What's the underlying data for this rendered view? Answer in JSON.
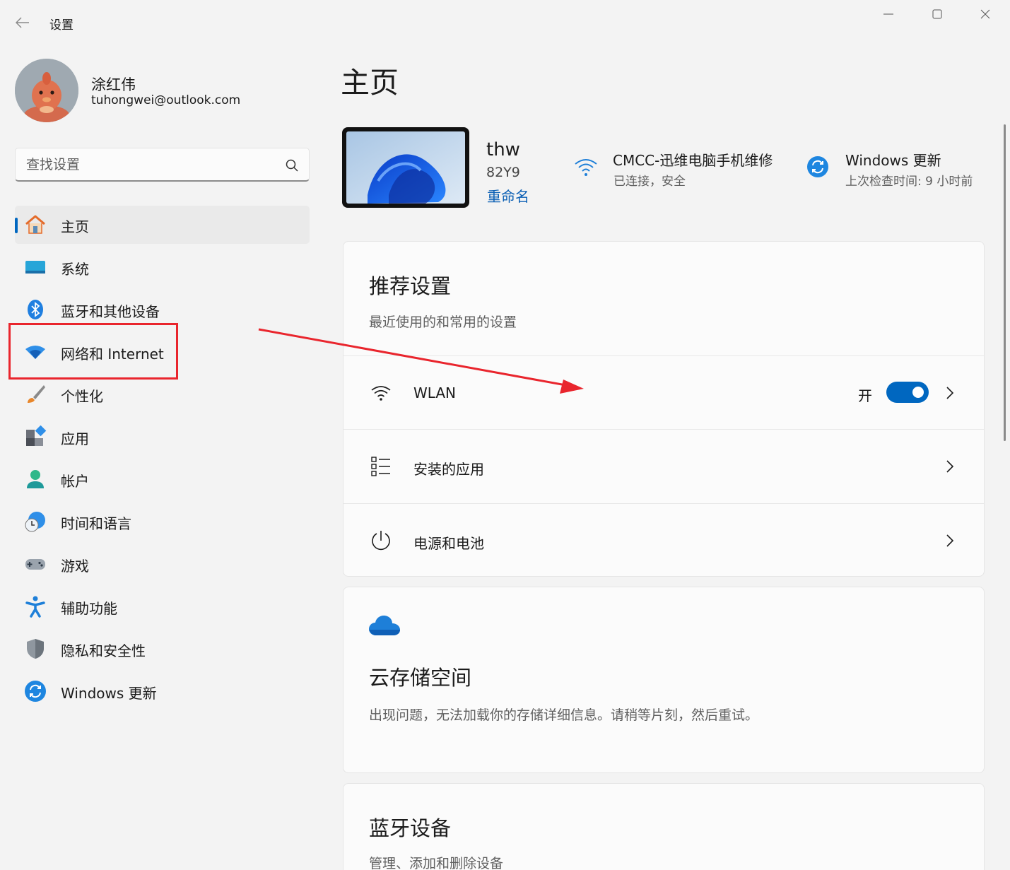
{
  "window": {
    "title": "设置"
  },
  "profile": {
    "name": "涂红伟",
    "email": "tuhongwei@outlook.com"
  },
  "search": {
    "placeholder": "查找设置"
  },
  "nav": {
    "items": [
      {
        "label": "主页",
        "icon": "home-icon",
        "active": true
      },
      {
        "label": "系统",
        "icon": "system-icon"
      },
      {
        "label": "蓝牙和其他设备",
        "icon": "bluetooth-icon"
      },
      {
        "label": "网络和 Internet",
        "icon": "network-icon"
      },
      {
        "label": "个性化",
        "icon": "brush-icon"
      },
      {
        "label": "应用",
        "icon": "apps-icon"
      },
      {
        "label": "帐户",
        "icon": "account-icon"
      },
      {
        "label": "时间和语言",
        "icon": "time-language-icon"
      },
      {
        "label": "游戏",
        "icon": "gamepad-icon"
      },
      {
        "label": "辅助功能",
        "icon": "accessibility-icon"
      },
      {
        "label": "隐私和安全性",
        "icon": "shield-icon"
      },
      {
        "label": "Windows 更新",
        "icon": "windows-update-icon"
      }
    ]
  },
  "main": {
    "title": "主页",
    "device": {
      "name": "thw",
      "model": "82Y9",
      "rename": "重命名"
    },
    "network": {
      "title": "CMCC-迅维电脑手机维修",
      "status": "已连接，安全"
    },
    "update": {
      "title": "Windows 更新",
      "status": "上次检查时间: 9 小时前"
    },
    "recommended": {
      "title": "推荐设置",
      "subtitle": "最近使用的和常用的设置",
      "rows": [
        {
          "label": "WLAN",
          "icon": "wifi-icon",
          "toggle_state": "开",
          "toggle_on": true
        },
        {
          "label": "安装的应用",
          "icon": "list-icon"
        },
        {
          "label": "电源和电池",
          "icon": "power-icon"
        }
      ]
    },
    "cloud": {
      "title": "云存储空间",
      "message": "出现问题，无法加载你的存储详细信息。请稍等片刻，然后重试。"
    },
    "bluetooth": {
      "title": "蓝牙设备",
      "subtitle": "管理、添加和删除设备"
    }
  },
  "colors": {
    "accent": "#0067c0",
    "annotation": "#e9252d",
    "background": "#f3f3f3",
    "card": "#fbfbfb"
  }
}
